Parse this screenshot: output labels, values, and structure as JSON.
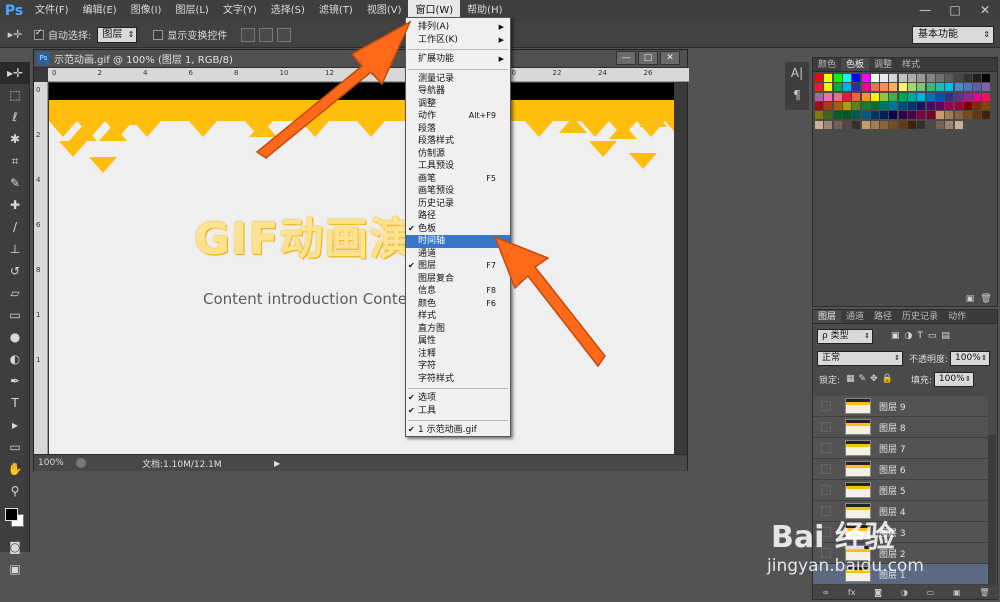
{
  "menubar": {
    "logo": "Ps",
    "items": [
      "文件(F)",
      "编辑(E)",
      "图像(I)",
      "图层(L)",
      "文字(Y)",
      "选择(S)",
      "滤镜(T)",
      "视图(V)",
      "窗口(W)",
      "帮助(H)"
    ],
    "active_index": 8,
    "window_controls": [
      "—",
      "□",
      "✕"
    ]
  },
  "options_bar": {
    "auto_select_label": "自动选择:",
    "auto_select_checked": true,
    "auto_select_value": "图层",
    "show_transform_label": "显示变换控件",
    "show_transform_checked": false,
    "workspace": "基本功能"
  },
  "tools": [
    "move-tool",
    "marquee-tool",
    "lasso-tool",
    "quick-select-tool",
    "crop-tool",
    "eyedropper-tool",
    "healing-tool",
    "brush-tool",
    "stamp-tool",
    "history-brush-tool",
    "eraser-tool",
    "gradient-tool",
    "blur-tool",
    "dodge-tool",
    "pen-tool",
    "type-tool",
    "path-select-tool",
    "shape-tool",
    "hand-tool",
    "zoom-tool"
  ],
  "document": {
    "title": "示范动画.gif @ 100% (图层 1, RGB/8)",
    "ruler_top": [
      "0",
      "2",
      "4",
      "6",
      "8",
      "10",
      "12",
      "14",
      "16",
      "18",
      "20",
      "22",
      "24",
      "26"
    ],
    "ruler_left": [
      "0",
      "2",
      "4",
      "6",
      "8",
      "1",
      "1"
    ],
    "canvas_title": "GIF动画演示",
    "canvas_subtitle": "Content introduction Content",
    "zoom": "100%",
    "doc_size": "文档:1.10M/12.1M"
  },
  "window_menu": {
    "groups": [
      [
        {
          "label": "排列(A)",
          "submenu": true
        },
        {
          "label": "工作区(K)",
          "submenu": true
        }
      ],
      [
        {
          "label": "扩展功能",
          "submenu": true
        }
      ],
      [
        {
          "label": "测量记录"
        },
        {
          "label": "导航器"
        },
        {
          "label": "调整"
        },
        {
          "label": "动作",
          "shortcut": "Alt+F9"
        },
        {
          "label": "段落"
        },
        {
          "label": "段落样式"
        },
        {
          "label": "仿制源"
        },
        {
          "label": "工具预设"
        },
        {
          "label": "画笔",
          "shortcut": "F5"
        },
        {
          "label": "画笔预设"
        },
        {
          "label": "历史记录"
        },
        {
          "label": "路径"
        },
        {
          "label": "色板",
          "checked": true
        },
        {
          "label": "时间轴",
          "highlighted": true
        },
        {
          "label": "通道"
        },
        {
          "label": "图层",
          "shortcut": "F7",
          "checked": true
        },
        {
          "label": "图层复合"
        },
        {
          "label": "信息",
          "shortcut": "F8"
        },
        {
          "label": "颜色",
          "shortcut": "F6"
        },
        {
          "label": "样式"
        },
        {
          "label": "直方图"
        },
        {
          "label": "属性"
        },
        {
          "label": "注释"
        },
        {
          "label": "字符"
        },
        {
          "label": "字符样式"
        }
      ],
      [
        {
          "label": "选项",
          "checked": true
        },
        {
          "label": "工具",
          "checked": true
        }
      ],
      [
        {
          "label": "1 示范动画.gif",
          "checked": true
        }
      ]
    ]
  },
  "swatch_panel": {
    "tabs": [
      "颜色",
      "色板",
      "调整",
      "样式"
    ],
    "active_tab": 1
  },
  "layers_panel": {
    "tabs": [
      "图层",
      "通道",
      "路径",
      "历史记录",
      "动作"
    ],
    "active_tab": 0,
    "filter_label": "ρ 类型",
    "blend_mode": "正常",
    "opacity_label": "不透明度:",
    "opacity_value": "100%",
    "lock_label": "锁定:",
    "fill_label": "填充:",
    "fill_value": "100%",
    "layers": [
      "图层 9",
      "图层 8",
      "图层 7",
      "图层 6",
      "图层 5",
      "图层 4",
      "图层 3",
      "图层 2",
      "图层 1"
    ],
    "selected_layer": "图层 1"
  },
  "watermark": {
    "brand": "Bai 经验",
    "url": "jingyan.baidu.com"
  },
  "colors": {
    "menu_highlight": "#3876c9",
    "arrow": "#ff6a1a",
    "canvas_yellow": "#ffbe0d"
  }
}
